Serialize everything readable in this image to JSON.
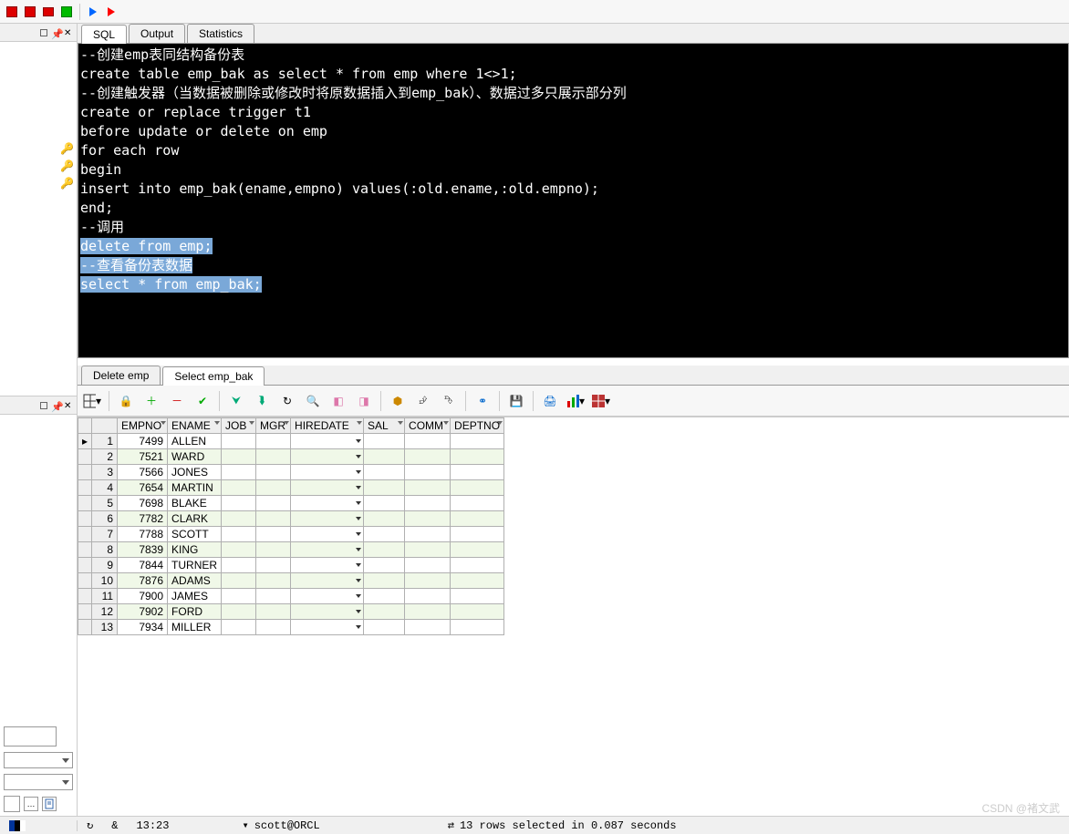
{
  "toolbar": {},
  "right_tabs": {
    "sql": "SQL",
    "output": "Output",
    "statistics": "Statistics"
  },
  "sql_lines": [
    "--创建emp表同结构备份表",
    "create table emp_bak as select * from emp where 1<>1;",
    "--创建触发器（当数据被删除或修改时将原数据插入到emp_bak）、数据过多只展示部分列",
    "create or replace trigger t1",
    "before update or delete on emp",
    "for each row",
    "begin",
    "  insert into emp_bak(ename,empno) values(:old.ename,:old.empno);",
    "end;",
    "--调用"
  ],
  "sql_selected": [
    "delete from emp;",
    "--查看备份表数据",
    "select * from emp_bak;"
  ],
  "result_tabs": {
    "t1": "Delete emp",
    "t2": "Select emp_bak"
  },
  "grid": {
    "headers": [
      "EMPNO",
      "ENAME",
      "JOB",
      "MGR",
      "HIREDATE",
      "SAL",
      "COMM",
      "DEPTNO"
    ],
    "rows": [
      {
        "n": 1,
        "empno": "7499",
        "ename": "ALLEN"
      },
      {
        "n": 2,
        "empno": "7521",
        "ename": "WARD"
      },
      {
        "n": 3,
        "empno": "7566",
        "ename": "JONES"
      },
      {
        "n": 4,
        "empno": "7654",
        "ename": "MARTIN"
      },
      {
        "n": 5,
        "empno": "7698",
        "ename": "BLAKE"
      },
      {
        "n": 6,
        "empno": "7782",
        "ename": "CLARK"
      },
      {
        "n": 7,
        "empno": "7788",
        "ename": "SCOTT"
      },
      {
        "n": 8,
        "empno": "7839",
        "ename": "KING"
      },
      {
        "n": 9,
        "empno": "7844",
        "ename": "TURNER"
      },
      {
        "n": 10,
        "empno": "7876",
        "ename": "ADAMS"
      },
      {
        "n": 11,
        "empno": "7900",
        "ename": "JAMES"
      },
      {
        "n": 12,
        "empno": "7902",
        "ename": "FORD"
      },
      {
        "n": 13,
        "empno": "7934",
        "ename": "MILLER"
      }
    ]
  },
  "status": {
    "and": "&",
    "pos": "13:23",
    "conn_pre": "▾ ",
    "conn": "scott@ORCL",
    "msg": "13 rows selected in 0.087 seconds"
  },
  "watermark": "CSDN @褚文武"
}
